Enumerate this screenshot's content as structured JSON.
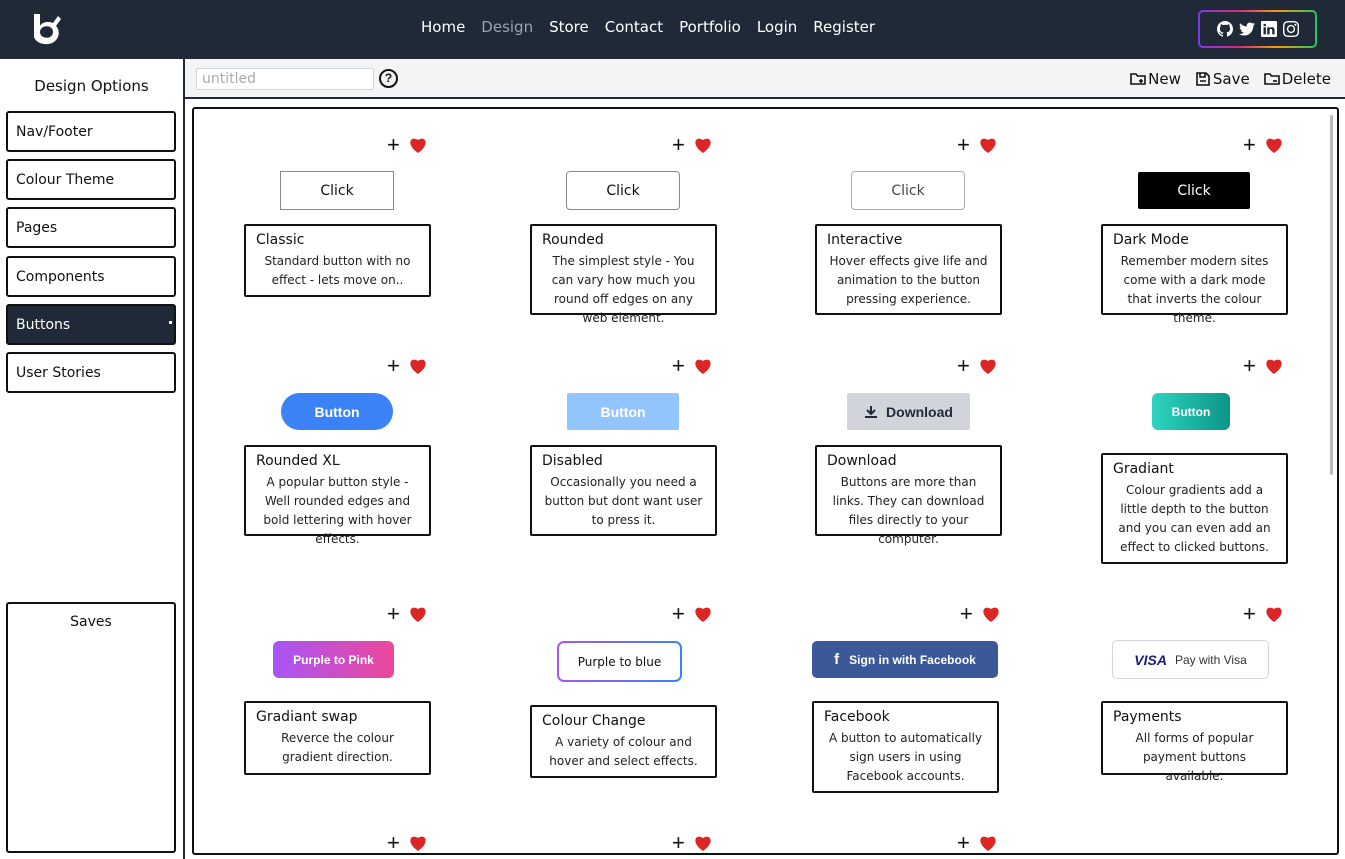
{
  "header": {
    "nav": [
      "Home",
      "Design",
      "Store",
      "Contact",
      "Portfolio",
      "Login",
      "Register"
    ],
    "active_nav": "Design",
    "social_icons": [
      "github-icon",
      "twitter-icon",
      "linkedin-icon",
      "instagram-icon"
    ]
  },
  "sidebar": {
    "title": "Design Options",
    "items": [
      "Nav/Footer",
      "Colour Theme",
      "Pages",
      "Components",
      "Buttons",
      "User Stories"
    ],
    "active_item": "Buttons",
    "saves_title": "Saves"
  },
  "toolbar": {
    "name_placeholder": "untitled",
    "help": "?",
    "new_label": "New",
    "save_label": "Save",
    "delete_label": "Delete"
  },
  "cards": [
    {
      "button": "Click",
      "title": "Classic",
      "desc": "Standard button with no effect - lets move on.."
    },
    {
      "button": "Click",
      "title": "Rounded",
      "desc": "The simplest style - You can vary how much you round off edges on any web element."
    },
    {
      "button": "Click",
      "title": "Interactive",
      "desc": "Hover effects give life and animation to the button pressing experience."
    },
    {
      "button": "Click",
      "title": "Dark Mode",
      "desc": "Remember modern sites come with a dark mode that inverts the colour theme."
    },
    {
      "button": "Button",
      "title": "Rounded XL",
      "desc": "A popular button style - Well rounded edges and bold lettering with hover effects."
    },
    {
      "button": "Button",
      "title": "Disabled",
      "desc": "Occasionally you need a button but dont want user to press it."
    },
    {
      "button": "Download",
      "title": "Download",
      "desc": "Buttons are more than links. They can download files directly to your computer."
    },
    {
      "button": "Button",
      "title": "Gradiant",
      "desc": "Colour gradients add a little depth to the button and you can even add an effect to clicked buttons."
    },
    {
      "button": "Purple to Pink",
      "title": "Gradiant swap",
      "desc": "Reverce the colour gradient direction."
    },
    {
      "button": "Purple to blue",
      "title": "Colour Change",
      "desc": "A variety of colour and hover and select effects."
    },
    {
      "button": "Sign in with Facebook",
      "title": "Facebook",
      "desc": "A button to automatically sign users in using Facebook accounts."
    },
    {
      "button": "Pay with Visa",
      "title": "Payments",
      "desc": "All forms of popular payment buttons available."
    }
  ],
  "visa_logo": "VISA",
  "colors": {
    "header_bg": "#1f2937",
    "heart": "#dc2626",
    "primary_blue": "#3b82f6",
    "facebook_blue": "#3b5998"
  }
}
